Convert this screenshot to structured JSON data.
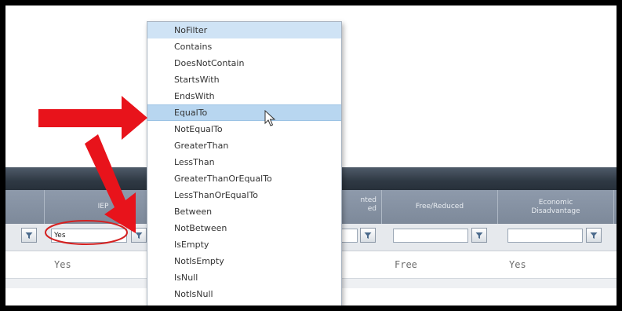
{
  "grid": {
    "columns": [
      {
        "label": ""
      },
      {
        "label": "IEP"
      },
      {
        "label": ""
      },
      {
        "label": "...nted\n...ed"
      },
      {
        "label": "Free/Reduced"
      },
      {
        "label": "Economic\nDisadvantage"
      }
    ],
    "filters": {
      "iep_value": "Yes"
    },
    "row": {
      "iep": "Yes",
      "free_reduced": "Free",
      "economic_disadvantage": "Yes"
    }
  },
  "filter_menu": {
    "options": [
      "NoFilter",
      "Contains",
      "DoesNotContain",
      "StartsWith",
      "EndsWith",
      "EqualTo",
      "NotEqualTo",
      "GreaterThan",
      "LessThan",
      "GreaterThanOrEqualTo",
      "LessThanOrEqualTo",
      "Between",
      "NotBetween",
      "IsEmpty",
      "NotIsEmpty",
      "IsNull",
      "NotIsNull"
    ],
    "selected": "NoFilter",
    "hovered": "EqualTo"
  },
  "annotation": {
    "arrow_color": "#e8131b",
    "circle_color": "#d42020"
  },
  "icons": {
    "filter": "funnel-icon",
    "cursor": "mouse-pointer-icon"
  }
}
